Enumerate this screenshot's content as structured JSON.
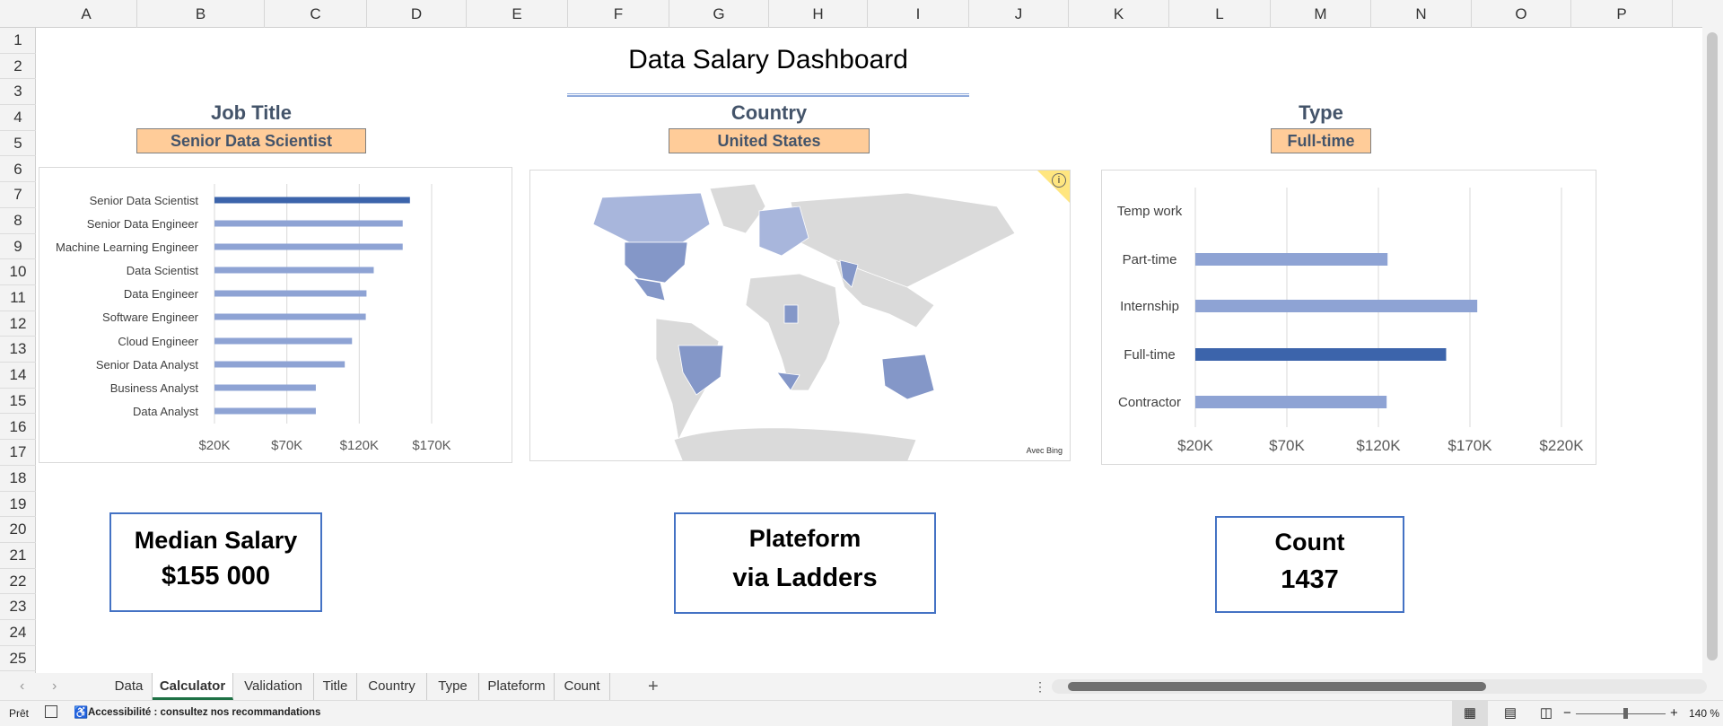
{
  "columns": [
    "A",
    "B",
    "C",
    "D",
    "E",
    "F",
    "G",
    "H",
    "I",
    "J",
    "K",
    "L",
    "M",
    "N",
    "O",
    "P"
  ],
  "rows": [
    "1",
    "2",
    "3",
    "4",
    "5",
    "6",
    "7",
    "8",
    "9",
    "10",
    "11",
    "12",
    "13",
    "14",
    "15",
    "16",
    "17",
    "18",
    "19",
    "20",
    "21",
    "22",
    "23",
    "24",
    "25"
  ],
  "dashboard": {
    "title": "Data Salary Dashboard",
    "filters": {
      "job_title": {
        "label": "Job Title",
        "value": "Senior Data Scientist"
      },
      "country": {
        "label": "Country",
        "value": "United States"
      },
      "type": {
        "label": "Type",
        "value": "Full-time"
      }
    },
    "map": {
      "credit": "Avec Bing",
      "info_icon": "info-icon",
      "highlight_color": "#8497c8",
      "land_color": "#dadada"
    },
    "kpis": {
      "median": {
        "label": "Median Salary",
        "value": "$155 000"
      },
      "platform": {
        "label": "Plateform",
        "value": "via Ladders"
      },
      "count": {
        "label": "Count",
        "value": "1437"
      }
    }
  },
  "chart_data": [
    {
      "type": "bar",
      "orientation": "horizontal",
      "title": "",
      "categories": [
        "Senior Data Scientist",
        "Senior Data Engineer",
        "Machine Learning Engineer",
        "Data Scientist",
        "Data Engineer",
        "Software Engineer",
        "Cloud Engineer",
        "Senior Data Analyst",
        "Business Analyst",
        "Data Analyst"
      ],
      "values": [
        155000,
        150000,
        150000,
        130000,
        125000,
        124500,
        115000,
        110000,
        90000,
        90000
      ],
      "highlight": "Senior Data Scientist",
      "xlim": [
        20000,
        190000
      ],
      "xticks": [
        "$20K",
        "$70K",
        "$120K",
        "$170K"
      ],
      "xtick_values": [
        20000,
        70000,
        120000,
        170000
      ],
      "colors": {
        "bar": "#8ea3d4",
        "highlight": "#3c64ab"
      }
    },
    {
      "type": "bar",
      "orientation": "horizontal",
      "title": "",
      "categories": [
        "Temp work",
        "Part-time",
        "Internship",
        "Full-time",
        "Contractor"
      ],
      "values": [
        null,
        125000,
        174000,
        157000,
        124500
      ],
      "highlight": "Full-time",
      "xlim": [
        20000,
        235000
      ],
      "xticks": [
        "$20K",
        "$70K",
        "$120K",
        "$170K",
        "$220K"
      ],
      "xtick_values": [
        20000,
        70000,
        120000,
        170000,
        220000
      ],
      "colors": {
        "bar": "#8ea3d4",
        "highlight": "#3c64ab"
      }
    }
  ],
  "sheet_tabs": [
    "Data",
    "Calculator",
    "Validation",
    "Title",
    "Country",
    "Type",
    "Plateform",
    "Count"
  ],
  "active_tab": "Calculator",
  "add_sheet": "+",
  "status": {
    "ready": "Prêt",
    "accessibility": "Accessibilité : consultez nos recommandations",
    "zoom": "140 %",
    "zoom_minus": "−",
    "zoom_plus": "+"
  }
}
